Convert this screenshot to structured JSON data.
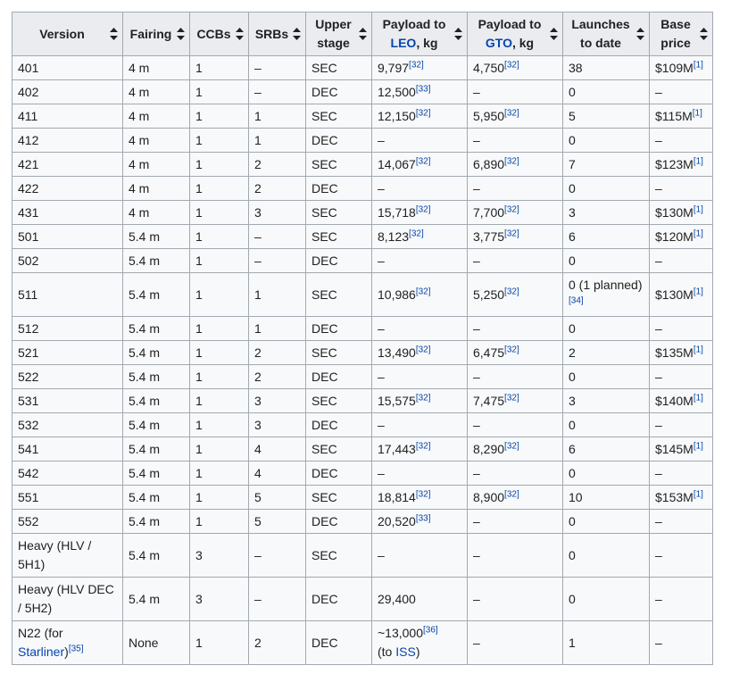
{
  "columns": [
    {
      "key": "version",
      "lines": [
        "Version"
      ]
    },
    {
      "key": "fairing",
      "lines": [
        "Fairing"
      ]
    },
    {
      "key": "ccbs",
      "lines": [
        "CCBs"
      ]
    },
    {
      "key": "srbs",
      "lines": [
        "SRBs"
      ]
    },
    {
      "key": "upper",
      "lines": [
        "Upper",
        "stage"
      ]
    },
    {
      "key": "leo",
      "lines": [
        "Payload to",
        "LEO, kg"
      ],
      "link": "LEO",
      "rest": ", kg"
    },
    {
      "key": "gto",
      "lines": [
        "Payload to",
        "GTO, kg"
      ],
      "link": "GTO",
      "rest": ", kg"
    },
    {
      "key": "launches",
      "lines": [
        "Launches",
        "to date"
      ]
    },
    {
      "key": "price",
      "lines": [
        "Base",
        "price"
      ]
    }
  ],
  "rows": [
    {
      "version": "401",
      "fairing": "4 m",
      "ccbs": "1",
      "srbs": "–",
      "upper": "SEC",
      "leo": "9,797",
      "leo_ref": "[32]",
      "gto": "4,750",
      "gto_ref": "[32]",
      "launches": "38",
      "price": "$109M",
      "price_ref": "[1]"
    },
    {
      "version": "402",
      "fairing": "4 m",
      "ccbs": "1",
      "srbs": "–",
      "upper": "DEC",
      "leo": "12,500",
      "leo_ref": "[33]",
      "gto": "–",
      "launches": "0",
      "price": "–"
    },
    {
      "version": "411",
      "fairing": "4 m",
      "ccbs": "1",
      "srbs": "1",
      "upper": "SEC",
      "leo": "12,150",
      "leo_ref": "[32]",
      "gto": "5,950",
      "gto_ref": "[32]",
      "launches": "5",
      "price": "$115M",
      "price_ref": "[1]"
    },
    {
      "version": "412",
      "fairing": "4 m",
      "ccbs": "1",
      "srbs": "1",
      "upper": "DEC",
      "leo": "–",
      "gto": "–",
      "launches": "0",
      "price": "–"
    },
    {
      "version": "421",
      "fairing": "4 m",
      "ccbs": "1",
      "srbs": "2",
      "upper": "SEC",
      "leo": "14,067",
      "leo_ref": "[32]",
      "gto": "6,890",
      "gto_ref": "[32]",
      "launches": "7",
      "price": "$123M",
      "price_ref": "[1]"
    },
    {
      "version": "422",
      "fairing": "4 m",
      "ccbs": "1",
      "srbs": "2",
      "upper": "DEC",
      "leo": "–",
      "gto": "–",
      "launches": "0",
      "price": "–"
    },
    {
      "version": "431",
      "fairing": "4 m",
      "ccbs": "1",
      "srbs": "3",
      "upper": "SEC",
      "leo": "15,718",
      "leo_ref": "[32]",
      "gto": "7,700",
      "gto_ref": "[32]",
      "launches": "3",
      "price": "$130M",
      "price_ref": "[1]"
    },
    {
      "version": "501",
      "fairing": "5.4 m",
      "ccbs": "1",
      "srbs": "–",
      "upper": "SEC",
      "leo": "8,123",
      "leo_ref": "[32]",
      "gto": "3,775",
      "gto_ref": "[32]",
      "launches": "6",
      "price": "$120M",
      "price_ref": "[1]"
    },
    {
      "version": "502",
      "fairing": "5.4 m",
      "ccbs": "1",
      "srbs": "–",
      "upper": "DEC",
      "leo": "–",
      "gto": "–",
      "launches": "0",
      "price": "–"
    },
    {
      "version": "511",
      "fairing": "5.4 m",
      "ccbs": "1",
      "srbs": "1",
      "upper": "SEC",
      "leo": "10,986",
      "leo_ref": "[32]",
      "gto": "5,250",
      "gto_ref": "[32]",
      "launches": "0 (1 planned)",
      "launches_ref": "[34]",
      "price": "$130M",
      "price_ref": "[1]",
      "tall": true
    },
    {
      "version": "512",
      "fairing": "5.4 m",
      "ccbs": "1",
      "srbs": "1",
      "upper": "DEC",
      "leo": "–",
      "gto": "–",
      "launches": "0",
      "price": "–"
    },
    {
      "version": "521",
      "fairing": "5.4 m",
      "ccbs": "1",
      "srbs": "2",
      "upper": "SEC",
      "leo": "13,490",
      "leo_ref": "[32]",
      "gto": "6,475",
      "gto_ref": "[32]",
      "launches": "2",
      "price": "$135M",
      "price_ref": "[1]"
    },
    {
      "version": "522",
      "fairing": "5.4 m",
      "ccbs": "1",
      "srbs": "2",
      "upper": "DEC",
      "leo": "–",
      "gto": "–",
      "launches": "0",
      "price": "–"
    },
    {
      "version": "531",
      "fairing": "5.4 m",
      "ccbs": "1",
      "srbs": "3",
      "upper": "SEC",
      "leo": "15,575",
      "leo_ref": "[32]",
      "gto": "7,475",
      "gto_ref": "[32]",
      "launches": "3",
      "price": "$140M",
      "price_ref": "[1]"
    },
    {
      "version": "532",
      "fairing": "5.4 m",
      "ccbs": "1",
      "srbs": "3",
      "upper": "DEC",
      "leo": "–",
      "gto": "–",
      "launches": "0",
      "price": "–"
    },
    {
      "version": "541",
      "fairing": "5.4 m",
      "ccbs": "1",
      "srbs": "4",
      "upper": "SEC",
      "leo": "17,443",
      "leo_ref": "[32]",
      "gto": "8,290",
      "gto_ref": "[32]",
      "launches": "6",
      "price": "$145M",
      "price_ref": "[1]"
    },
    {
      "version": "542",
      "fairing": "5.4 m",
      "ccbs": "1",
      "srbs": "4",
      "upper": "DEC",
      "leo": "–",
      "gto": "–",
      "launches": "0",
      "price": "–"
    },
    {
      "version": "551",
      "fairing": "5.4 m",
      "ccbs": "1",
      "srbs": "5",
      "upper": "SEC",
      "leo": "18,814",
      "leo_ref": "[32]",
      "gto": "8,900",
      "gto_ref": "[32]",
      "launches": "10",
      "price": "$153M",
      "price_ref": "[1]"
    },
    {
      "version": "552",
      "fairing": "5.4 m",
      "ccbs": "1",
      "srbs": "5",
      "upper": "DEC",
      "leo": "20,520",
      "leo_ref": "[33]",
      "gto": "–",
      "launches": "0",
      "price": "–"
    },
    {
      "version": "Heavy (HLV / 5H1)",
      "fairing": "5.4 m",
      "ccbs": "3",
      "srbs": "–",
      "upper": "SEC",
      "leo": "–",
      "gto": "–",
      "launches": "0",
      "price": "–",
      "tall": true
    },
    {
      "version": "Heavy (HLV DEC / 5H2)",
      "fairing": "5.4 m",
      "ccbs": "3",
      "srbs": "–",
      "upper": "DEC",
      "leo": "29,400",
      "gto": "–",
      "launches": "0",
      "price": "–",
      "tall": true
    },
    {
      "version": "N22 (for ",
      "version_link": "Starliner",
      "version_tail": ")",
      "version_ref": "[35]",
      "fairing": "None",
      "ccbs": "1",
      "srbs": "2",
      "upper": "DEC",
      "leo": "~13,000",
      "leo_ref": "[36]",
      "leo_line2_pre": "(to ",
      "leo_line2_link": "ISS",
      "leo_line2_post": ")",
      "gto": "–",
      "launches": "1",
      "price": "–",
      "tall": true
    }
  ]
}
